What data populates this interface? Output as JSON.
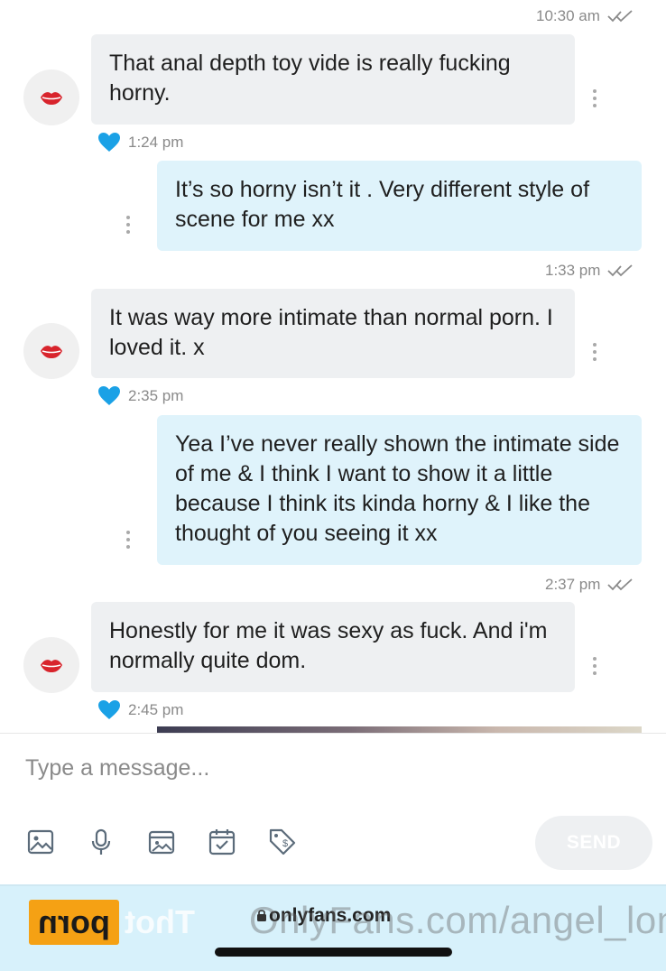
{
  "messages": [
    {
      "direction": "out",
      "time": "10:30 am",
      "read": true
    },
    {
      "direction": "in",
      "text": "That anal depth toy vide is really fucking horny.",
      "time": "1:24 pm",
      "liked": true
    },
    {
      "direction": "out",
      "text": "It’s so horny isn’t it . Very different style of scene for me xx",
      "time": "1:33 pm",
      "read": true
    },
    {
      "direction": "in",
      "text": "It was way more intimate than normal porn. I loved it. x",
      "time": "2:35 pm",
      "liked": true
    },
    {
      "direction": "out",
      "text": "Yea I’ve never really shown the intimate side of me & I think I want to show it a little because I think its kinda horny & I like the thought of you seeing it xx",
      "time": "2:37 pm",
      "read": true
    },
    {
      "direction": "in",
      "text": "Honestly for me it was sexy as fuck. And i'm normally quite dom.",
      "time": "2:45 pm",
      "liked": true
    }
  ],
  "composer": {
    "placeholder": "Type a message...",
    "send_label": "SEND",
    "tools": [
      "image-icon",
      "microphone-icon",
      "media-vault-icon",
      "schedule-icon",
      "price-tag-icon"
    ]
  },
  "browser": {
    "url": "onlyfans.com"
  },
  "watermark": {
    "url": "OnlyFans.com/angel_long",
    "badge": "porn",
    "word": "Thot"
  },
  "colors": {
    "incoming_bubble": "#eef0f2",
    "outgoing_bubble": "#dff3fb",
    "heart": "#1aa1e6",
    "avatar_lips": "#d8242c",
    "browser_bar": "#d7f1fb"
  }
}
